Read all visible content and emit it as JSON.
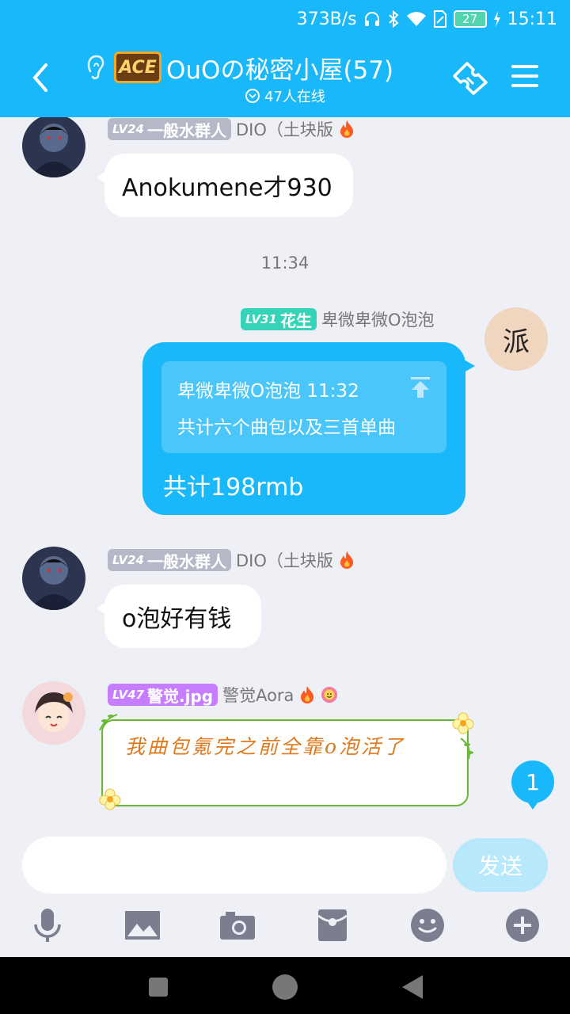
{
  "status": {
    "network_speed": "373B/s",
    "battery": "27",
    "time": "15:11"
  },
  "header": {
    "title": "OuOの秘密小屋(57)",
    "logo_text": "ACE",
    "online": "47人在线"
  },
  "messages": [
    {
      "badge_level": "LV24",
      "badge_title": "一般水群人",
      "name": "DIO（土块版",
      "text": "Anokumene才930"
    },
    {
      "type": "time",
      "text": "11:34"
    },
    {
      "badge_level": "LV31",
      "badge_title": "花生",
      "name": "卑微卑微O泡泡",
      "avatar_char": "派",
      "quote_header": "卑微卑微O泡泡 11:32",
      "quote_text": "共计六个曲包以及三首单曲",
      "text": "共计198rmb"
    },
    {
      "badge_level": "LV24",
      "badge_title": "一般水群人",
      "name": "DIO（土块版",
      "text": "o泡好有钱"
    },
    {
      "badge_level": "LV47",
      "badge_title": "警觉.jpg",
      "name": "警觉Aora",
      "text": "我曲包氪完之前全靠o泡活了"
    }
  ],
  "unread_count": "1",
  "input": {
    "placeholder": "",
    "send_label": "发送"
  },
  "colors": {
    "primary": "#19b8fb",
    "background": "#eff0f5"
  }
}
